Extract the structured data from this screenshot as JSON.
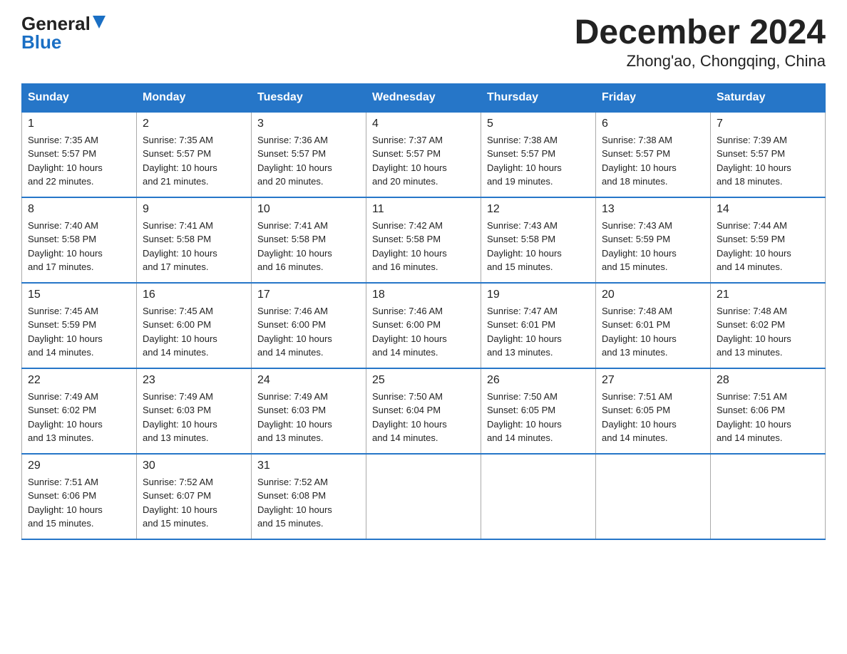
{
  "logo": {
    "general": "General",
    "blue": "Blue",
    "triangle": "▼"
  },
  "title": "December 2024",
  "subtitle": "Zhong'ao, Chongqing, China",
  "days_of_week": [
    "Sunday",
    "Monday",
    "Tuesday",
    "Wednesday",
    "Thursday",
    "Friday",
    "Saturday"
  ],
  "weeks": [
    [
      {
        "day": "1",
        "sunrise": "7:35 AM",
        "sunset": "5:57 PM",
        "daylight": "10 hours and 22 minutes."
      },
      {
        "day": "2",
        "sunrise": "7:35 AM",
        "sunset": "5:57 PM",
        "daylight": "10 hours and 21 minutes."
      },
      {
        "day": "3",
        "sunrise": "7:36 AM",
        "sunset": "5:57 PM",
        "daylight": "10 hours and 20 minutes."
      },
      {
        "day": "4",
        "sunrise": "7:37 AM",
        "sunset": "5:57 PM",
        "daylight": "10 hours and 20 minutes."
      },
      {
        "day": "5",
        "sunrise": "7:38 AM",
        "sunset": "5:57 PM",
        "daylight": "10 hours and 19 minutes."
      },
      {
        "day": "6",
        "sunrise": "7:38 AM",
        "sunset": "5:57 PM",
        "daylight": "10 hours and 18 minutes."
      },
      {
        "day": "7",
        "sunrise": "7:39 AM",
        "sunset": "5:57 PM",
        "daylight": "10 hours and 18 minutes."
      }
    ],
    [
      {
        "day": "8",
        "sunrise": "7:40 AM",
        "sunset": "5:58 PM",
        "daylight": "10 hours and 17 minutes."
      },
      {
        "day": "9",
        "sunrise": "7:41 AM",
        "sunset": "5:58 PM",
        "daylight": "10 hours and 17 minutes."
      },
      {
        "day": "10",
        "sunrise": "7:41 AM",
        "sunset": "5:58 PM",
        "daylight": "10 hours and 16 minutes."
      },
      {
        "day": "11",
        "sunrise": "7:42 AM",
        "sunset": "5:58 PM",
        "daylight": "10 hours and 16 minutes."
      },
      {
        "day": "12",
        "sunrise": "7:43 AM",
        "sunset": "5:58 PM",
        "daylight": "10 hours and 15 minutes."
      },
      {
        "day": "13",
        "sunrise": "7:43 AM",
        "sunset": "5:59 PM",
        "daylight": "10 hours and 15 minutes."
      },
      {
        "day": "14",
        "sunrise": "7:44 AM",
        "sunset": "5:59 PM",
        "daylight": "10 hours and 14 minutes."
      }
    ],
    [
      {
        "day": "15",
        "sunrise": "7:45 AM",
        "sunset": "5:59 PM",
        "daylight": "10 hours and 14 minutes."
      },
      {
        "day": "16",
        "sunrise": "7:45 AM",
        "sunset": "6:00 PM",
        "daylight": "10 hours and 14 minutes."
      },
      {
        "day": "17",
        "sunrise": "7:46 AM",
        "sunset": "6:00 PM",
        "daylight": "10 hours and 14 minutes."
      },
      {
        "day": "18",
        "sunrise": "7:46 AM",
        "sunset": "6:00 PM",
        "daylight": "10 hours and 14 minutes."
      },
      {
        "day": "19",
        "sunrise": "7:47 AM",
        "sunset": "6:01 PM",
        "daylight": "10 hours and 13 minutes."
      },
      {
        "day": "20",
        "sunrise": "7:48 AM",
        "sunset": "6:01 PM",
        "daylight": "10 hours and 13 minutes."
      },
      {
        "day": "21",
        "sunrise": "7:48 AM",
        "sunset": "6:02 PM",
        "daylight": "10 hours and 13 minutes."
      }
    ],
    [
      {
        "day": "22",
        "sunrise": "7:49 AM",
        "sunset": "6:02 PM",
        "daylight": "10 hours and 13 minutes."
      },
      {
        "day": "23",
        "sunrise": "7:49 AM",
        "sunset": "6:03 PM",
        "daylight": "10 hours and 13 minutes."
      },
      {
        "day": "24",
        "sunrise": "7:49 AM",
        "sunset": "6:03 PM",
        "daylight": "10 hours and 13 minutes."
      },
      {
        "day": "25",
        "sunrise": "7:50 AM",
        "sunset": "6:04 PM",
        "daylight": "10 hours and 14 minutes."
      },
      {
        "day": "26",
        "sunrise": "7:50 AM",
        "sunset": "6:05 PM",
        "daylight": "10 hours and 14 minutes."
      },
      {
        "day": "27",
        "sunrise": "7:51 AM",
        "sunset": "6:05 PM",
        "daylight": "10 hours and 14 minutes."
      },
      {
        "day": "28",
        "sunrise": "7:51 AM",
        "sunset": "6:06 PM",
        "daylight": "10 hours and 14 minutes."
      }
    ],
    [
      {
        "day": "29",
        "sunrise": "7:51 AM",
        "sunset": "6:06 PM",
        "daylight": "10 hours and 15 minutes."
      },
      {
        "day": "30",
        "sunrise": "7:52 AM",
        "sunset": "6:07 PM",
        "daylight": "10 hours and 15 minutes."
      },
      {
        "day": "31",
        "sunrise": "7:52 AM",
        "sunset": "6:08 PM",
        "daylight": "10 hours and 15 minutes."
      },
      null,
      null,
      null,
      null
    ]
  ],
  "labels": {
    "sunrise": "Sunrise:",
    "sunset": "Sunset:",
    "daylight": "Daylight:"
  }
}
